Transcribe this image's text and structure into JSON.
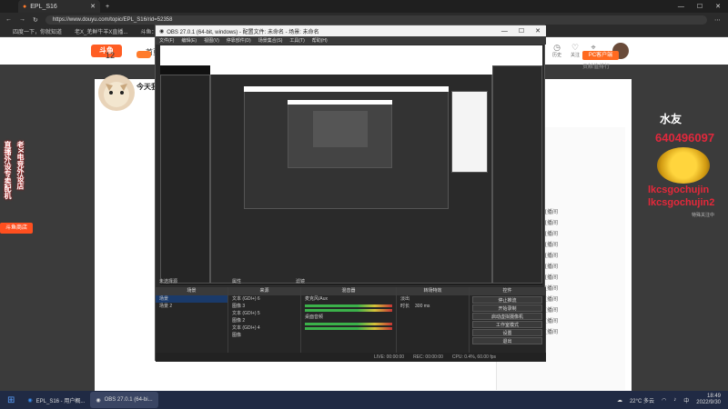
{
  "browser": {
    "tab_title": "EPL_S16",
    "url": "https://www.douyu.com/topic/EPL_S16/rid=52358",
    "favorites": [
      "四度一下，你就知道",
      "老X_羌鲜牛羊X直播...",
      "斗鱼：每个人..."
    ]
  },
  "douyu": {
    "logo": "斗鱼",
    "nav_home": "首页",
    "header_icons": [
      {
        "icon": "history-icon",
        "label": "历史"
      },
      {
        "icon": "follow-icon",
        "label": "关注"
      },
      {
        "icon": "game-icon",
        "label": "游戏"
      },
      {
        "icon": "location-icon",
        "label": "下载"
      },
      {
        "icon": "creator-icon",
        "label": "创作中心"
      }
    ],
    "room_number": "12",
    "today_text": "今天我",
    "pc_button": "PC客户端",
    "rank_link": "贡献值排行"
  },
  "left_overlay": {
    "col1": "老X电竞外设店",
    "col2": "直播外设专卖配机",
    "badge": "斗鱼商店"
  },
  "right_overlay": {
    "name": "水友",
    "number": "640496097",
    "users": [
      "lkcsgochujin",
      "lkcsgochujin2"
    ],
    "sub": "特殊关注中"
  },
  "chat": {
    "lines": [
      "欢迎来到本直播间",
      "欢迎来到本直播间",
      "欢迎来到本直播间",
      "欢迎来到本直播间",
      "欢迎来到本直播间",
      "欢迎来到本直播间",
      "欢迎来到本直播间",
      "欢迎来到本直播间",
      "欢迎来到本直播间",
      "欢迎来到本直播间",
      "欢迎来到本直播间",
      "欢迎来到本直播间"
    ]
  },
  "obs": {
    "title": "OBS 27.0.1 (64-bit, windows) - 配置文件: 未命名 - 场景: 未命名",
    "menu": [
      "文件(F)",
      "编辑(E)",
      "视图(V)",
      "停靠部件(D)",
      "场景集合(S)",
      "工具(T)",
      "帮助(H)"
    ],
    "scene_label": "未选择源",
    "props_label": "属性",
    "filters_label": "滤镜",
    "docks": {
      "scenes_title": "场景",
      "scenes": [
        "场景",
        "场景 2"
      ],
      "sources_title": "来源",
      "sources": [
        "文本 (GDI+) 6",
        "图像 3",
        "文本 (GDI+) 5",
        "图像 2",
        "文本 (GDI+) 4",
        "图像"
      ],
      "mixer_title": "混音器",
      "mixer": [
        "麦克风/Aux",
        "桌面音频"
      ],
      "transitions_title": "转场特效",
      "transition_name": "淡出",
      "duration_label": "时长",
      "duration_value": "300 ms",
      "controls_title": "控件",
      "controls": [
        "停止推流",
        "开始录制",
        "启动虚拟摄像机",
        "工作室模式",
        "设置",
        "退出"
      ]
    },
    "status": [
      "LIVE: 00:00:00",
      "REC: 00:00:00",
      "CPU: 0.4%, 60.00 fps"
    ]
  },
  "taskbar": {
    "apps": [
      "EPL_S16 - 用户概...",
      "OBS 27.0.1 (64-bi..."
    ],
    "weather": "22°C 多云",
    "lang": "中",
    "time": "18:49",
    "date": "2022/9/30"
  }
}
